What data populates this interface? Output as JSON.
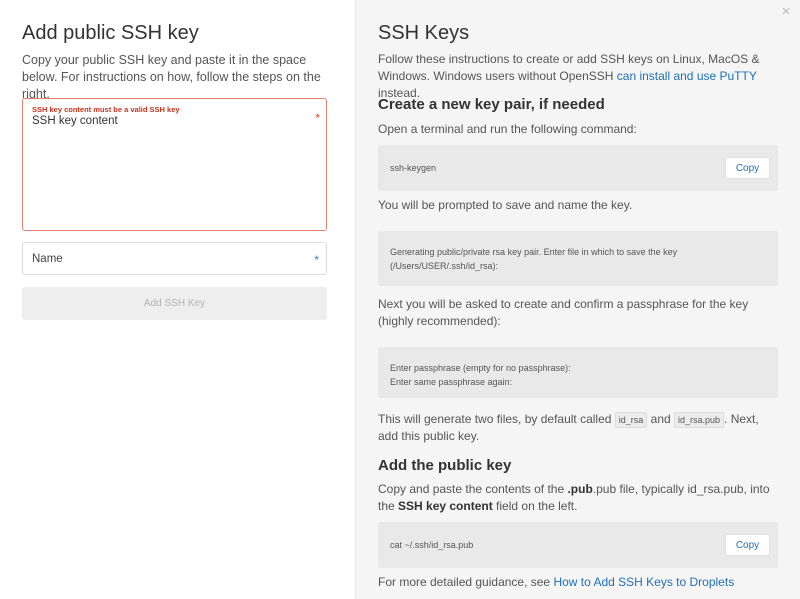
{
  "left": {
    "title": "Add public SSH key",
    "lead": "Copy your public SSH key and paste it in the space below. For instructions on how, follow the steps on the right.",
    "key_error": "SSH key content must be a valid SSH key",
    "key_placeholder": "SSH key content",
    "required_mark": "*",
    "name_placeholder": "Name",
    "add_button": "Add SSH Key"
  },
  "right": {
    "close_glyph": "×",
    "title": "SSH Keys",
    "intro_before": "Follow these instructions to create or add SSH keys on Linux, MacOS & Windows. Windows users without OpenSSH ",
    "intro_link": "can install and use PuTTY",
    "intro_after": " instead.",
    "create_heading": "Create a new key pair, if needed",
    "open_terminal": "Open a terminal and run the following command:",
    "cmd_keygen": "ssh-keygen",
    "copy_label": "Copy",
    "prompted": "You will be prompted to save and name the key.",
    "gen_output": "Generating public/private rsa key pair. Enter file in which to save the key (/Users/USER/.ssh/id_rsa):",
    "passphrase_text": "Next you will be asked to create and confirm a passphrase for the key (highly recommended):",
    "pass_line1": "Enter passphrase (empty for no passphrase):",
    "pass_line2": "Enter same passphrase again:",
    "two_files_a": "This will generate two files, by default called ",
    "file1": "id_rsa",
    "and": " and ",
    "file2": "id_rsa.pub",
    "two_files_b": ". Next, add this public key.",
    "add_heading": "Add the public key",
    "paste_a": "Copy and paste the contents of the ",
    "paste_bold1": ".pub",
    "paste_b": ".pub file, typically id_rsa.pub, into the ",
    "paste_bold2": "SSH key content",
    "paste_c": " field on the left.",
    "cmd_cat": "cat ~/.ssh/id_rsa.pub",
    "guidance_before": "For more detailed guidance, see ",
    "guidance_link": "How to Add SSH Keys to Droplets"
  }
}
